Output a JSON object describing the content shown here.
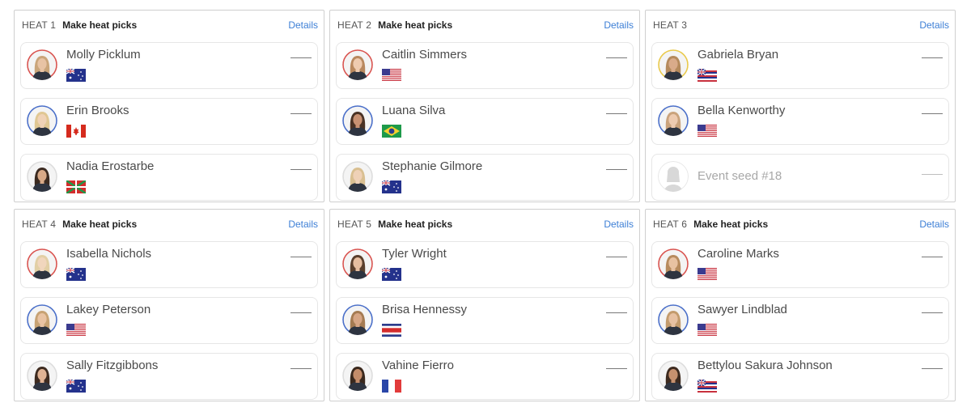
{
  "heats": [
    {
      "label": "HEAT 1",
      "action": "Make heat picks",
      "details": "Details",
      "surfers": [
        {
          "name": "Molly Picklum",
          "flag": "AUS",
          "ring": "#d9534f",
          "hair": "#caa57a",
          "skin": "#e8c3a4",
          "score": "——"
        },
        {
          "name": "Erin Brooks",
          "flag": "CAN",
          "ring": "#4a6fc9",
          "hair": "#e0c793",
          "skin": "#f0d2b6",
          "score": "——"
        },
        {
          "name": "Nadia Erostarbe",
          "flag": "BASQUE",
          "ring": "#dddddd",
          "hair": "#3b2a20",
          "skin": "#d8a987",
          "score": "——"
        }
      ]
    },
    {
      "label": "HEAT 2",
      "action": "Make heat picks",
      "details": "Details",
      "surfers": [
        {
          "name": "Caitlin Simmers",
          "flag": "USA",
          "ring": "#d9534f",
          "hair": "#b9885e",
          "skin": "#efcbb0",
          "score": "——"
        },
        {
          "name": "Luana Silva",
          "flag": "BRA",
          "ring": "#4a6fc9",
          "hair": "#4a3224",
          "skin": "#c89172",
          "score": "——"
        },
        {
          "name": "Stephanie Gilmore",
          "flag": "AUS",
          "ring": "#dddddd",
          "hair": "#d9bf91",
          "skin": "#efd1b7",
          "score": "——"
        }
      ]
    },
    {
      "label": "HEAT 3",
      "action": "",
      "details": "Details",
      "surfers": [
        {
          "name": "Gabriela Bryan",
          "flag": "HAWAII",
          "ring": "#e9c94a",
          "hair": "#b58a5c",
          "skin": "#d9ab8a",
          "score": "——"
        },
        {
          "name": "Bella Kenworthy",
          "flag": "USA",
          "ring": "#4a6fc9",
          "hair": "#caa37c",
          "skin": "#eecbb0",
          "score": "——"
        },
        {
          "name": "Event seed #18",
          "flag": "",
          "ring": "#dddddd",
          "hair": "",
          "skin": "",
          "score": "——",
          "placeholder": true
        }
      ]
    },
    {
      "label": "HEAT 4",
      "action": "Make heat picks",
      "details": "Details",
      "surfers": [
        {
          "name": "Isabella Nichols",
          "flag": "AUS",
          "ring": "#d9534f",
          "hair": "#e2cfa5",
          "skin": "#f1d6bd",
          "score": "——"
        },
        {
          "name": "Lakey Peterson",
          "flag": "USA",
          "ring": "#4a6fc9",
          "hair": "#c7a273",
          "skin": "#e9c3a3",
          "score": "——"
        },
        {
          "name": "Sally Fitzgibbons",
          "flag": "AUS",
          "ring": "#dddddd",
          "hair": "#3e2b20",
          "skin": "#e1b394",
          "score": "——"
        }
      ]
    },
    {
      "label": "HEAT 5",
      "action": "Make heat picks",
      "details": "Details",
      "surfers": [
        {
          "name": "Tyler Wright",
          "flag": "AUS",
          "ring": "#d9534f",
          "hair": "#5a3f2c",
          "skin": "#e6bea0",
          "score": "——"
        },
        {
          "name": "Brisa Hennessy",
          "flag": "CRC",
          "ring": "#4a6fc9",
          "hair": "#a57b52",
          "skin": "#d7a685",
          "score": "——"
        },
        {
          "name": "Vahine Fierro",
          "flag": "FRA",
          "ring": "#dddddd",
          "hair": "#3a281d",
          "skin": "#c48c6a",
          "score": "——"
        }
      ]
    },
    {
      "label": "HEAT 6",
      "action": "Make heat picks",
      "details": "Details",
      "surfers": [
        {
          "name": "Caroline Marks",
          "flag": "USA",
          "ring": "#d9534f",
          "hair": "#b78b5e",
          "skin": "#e8c2a2",
          "score": "——"
        },
        {
          "name": "Sawyer Lindblad",
          "flag": "USA",
          "ring": "#4a6fc9",
          "hair": "#c39b6c",
          "skin": "#e7c1a2",
          "score": "——"
        },
        {
          "name": "Bettylou Sakura Johnson",
          "flag": "HAWAII",
          "ring": "#dddddd",
          "hair": "#3d2a1f",
          "skin": "#c7916f",
          "score": "——"
        }
      ]
    }
  ]
}
